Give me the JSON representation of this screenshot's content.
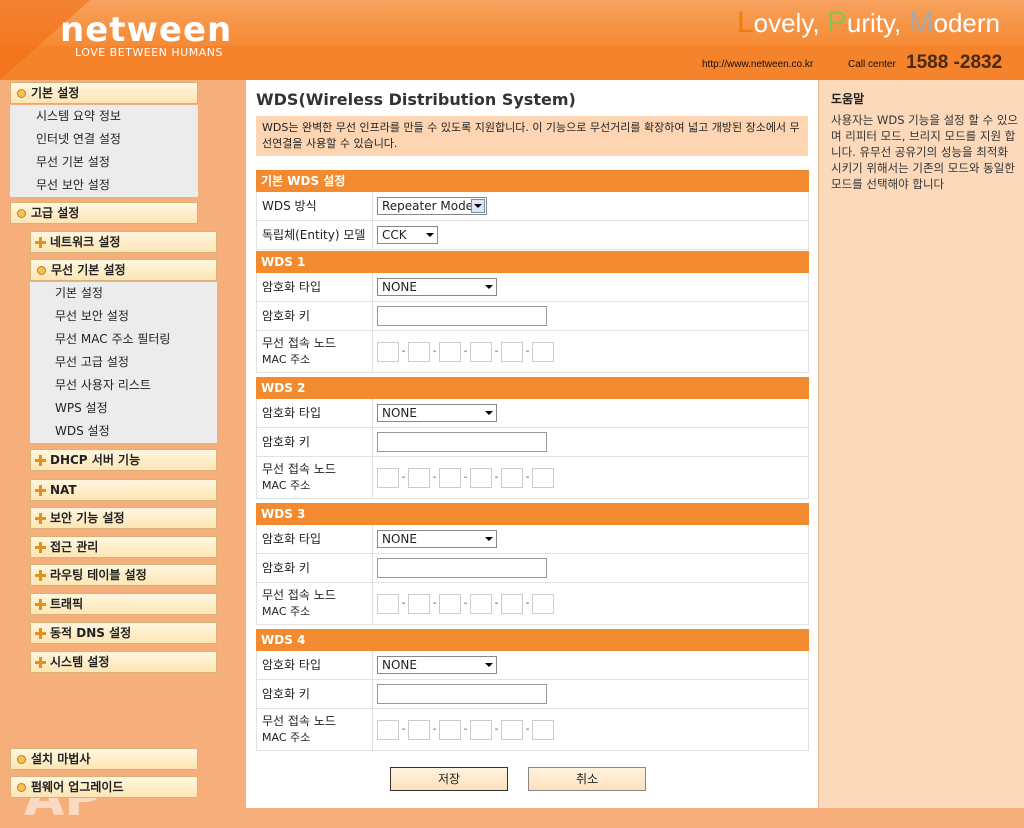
{
  "header": {
    "logo": "netween",
    "logo_sub": "LOVE BETWEEN HUMANS",
    "slogan": {
      "l1": "L",
      "r1": "ovely, ",
      "l2": "P",
      "r2": "urity, ",
      "l3": "M",
      "r3": "odern"
    },
    "url": "http://www.netween.co.kr",
    "call_label": "Call center",
    "phone": "1588 -2832"
  },
  "sidebar": {
    "basic": {
      "label": "기본 설정",
      "items": [
        "시스템 요약 정보",
        "인터넷 연결 설정",
        "무선 기본 설정",
        "무선 보안 설정"
      ]
    },
    "advanced": {
      "label": "고급 설정"
    },
    "network": "네트워크 설정",
    "wireless": {
      "label": "무선 기본 설정",
      "items": [
        "기본 설정",
        "무선 보안 설정",
        "무선 MAC 주소 필터링",
        "무선 고급 설정",
        "무선 사용자 리스트",
        "WPS 설정",
        "WDS 설정"
      ]
    },
    "more": [
      "DHCP 서버 기능",
      "NAT",
      "보안 기능 설정",
      "접근 관리",
      "라우팅 테이블 설정",
      "트래픽",
      "동적 DNS 설정",
      "시스템 설정"
    ],
    "bottom": [
      "설치 마법사",
      "펌웨어 업그레이드"
    ],
    "watermark": "AP"
  },
  "main": {
    "title": "WDS(Wireless Distribution System)",
    "desc": "WDS는 완벽한 무선 인프라를 만들 수 있도록 지원합니다. 이 기능으로 무선거리를 확장하여 넓고 개방된 장소에서 무선연결을 사용할 수 있습니다.",
    "basic": {
      "head": "기본 WDS 설정",
      "mode_label": "WDS 방식",
      "mode_value": "Repeater Mode",
      "entity_label": "독립체(Entity) 모델",
      "entity_value": "CCK"
    },
    "wds": [
      {
        "head": "WDS 1",
        "enc_label": "암호화 타입",
        "enc_value": "NONE",
        "key_label": "암호화 키",
        "node_label1": "무선 접속 노드",
        "node_label2": "MAC 주소"
      },
      {
        "head": "WDS 2",
        "enc_label": "암호화 타입",
        "enc_value": "NONE",
        "key_label": "암호화 키",
        "node_label1": "무선 접속 노드",
        "node_label2": "MAC 주소"
      },
      {
        "head": "WDS 3",
        "enc_label": "암호화 타입",
        "enc_value": "NONE",
        "key_label": "암호화 키",
        "node_label1": "무선 접속 노드",
        "node_label2": "MAC 주소"
      },
      {
        "head": "WDS 4",
        "enc_label": "암호화 타입",
        "enc_value": "NONE",
        "key_label": "암호화 키",
        "node_label1": "무선 접속 노드",
        "node_label2": "MAC 주소"
      }
    ],
    "save": "저장",
    "cancel": "취소"
  },
  "help": {
    "title": "도움말",
    "text": "사용자는 WDS 기능을 설정 할 수 있으며 리피터 모드, 브리지 모드를 지원 합니다. 유무선 공유기의 성능을 최적화 시키기 위해서는 기존의 모드와 동일한 모드를 선택해야 합니다"
  }
}
